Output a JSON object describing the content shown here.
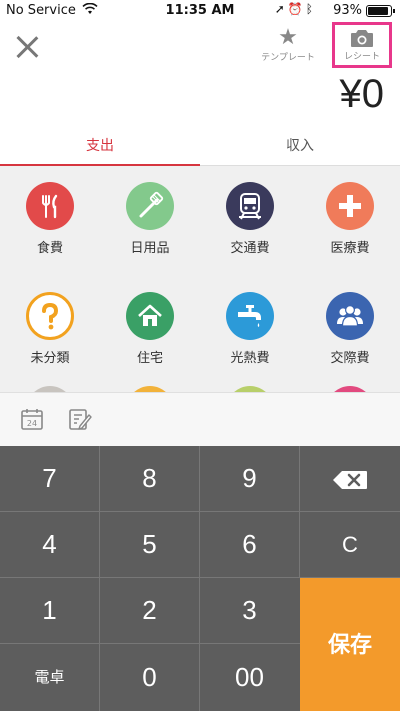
{
  "status_bar": {
    "carrier": "No Service",
    "time": "11:35 AM",
    "battery": "93%",
    "battery_level": 0.93,
    "icons": [
      "location-icon",
      "alarm-icon",
      "bluetooth-icon"
    ]
  },
  "header": {
    "close_icon": "close-icon",
    "template_label": "テンプレート",
    "receipt_label": "レシート",
    "amount": "¥0"
  },
  "tabs": [
    {
      "label": "支出",
      "active": true
    },
    {
      "label": "収入",
      "active": false
    }
  ],
  "categories": [
    {
      "label": "食費",
      "color": "#e24a4a",
      "icon": "utensils-icon"
    },
    {
      "label": "日用品",
      "color": "#83c98c",
      "icon": "toothbrush-icon"
    },
    {
      "label": "交通費",
      "color": "#3a3a5c",
      "icon": "train-icon"
    },
    {
      "label": "医療費",
      "color": "#f07b5a",
      "icon": "medical-cross-icon"
    },
    {
      "label": "未分類",
      "color": "#f2a21f",
      "icon": "question-icon"
    },
    {
      "label": "住宅",
      "color": "#3aa066",
      "icon": "house-icon"
    },
    {
      "label": "光熱費",
      "color": "#2c9ad8",
      "icon": "faucet-icon"
    },
    {
      "label": "交際費",
      "color": "#3b65b0",
      "icon": "people-icon"
    }
  ],
  "partial_category_colors": [
    "#c8c4bf",
    "#f2b23a",
    "#b8cf6a",
    "#e24a7f"
  ],
  "tools": {
    "calendar_day": "24"
  },
  "keypad": {
    "keys": [
      "7",
      "8",
      "9",
      "4",
      "5",
      "6",
      "C",
      "1",
      "2",
      "3",
      "0",
      "00"
    ],
    "calc_label": "電卓",
    "save_label": "保存",
    "save_color": "#f39a2b"
  }
}
